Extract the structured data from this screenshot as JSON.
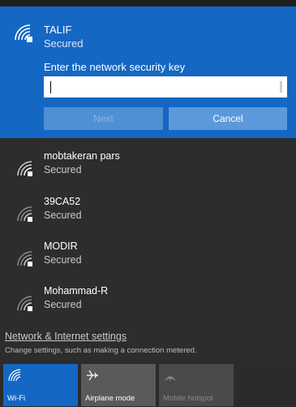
{
  "colors": {
    "accent": "#1567c4",
    "flyout_bg": "#2d2d2d",
    "button_disabled": "#4f8fd3",
    "button_active": "#5b99da"
  },
  "selected_network": {
    "icon": "wifi-secured-icon",
    "name": "TALIF",
    "status": "Secured",
    "key_label": "Enter the network security key",
    "key_value": "",
    "next_label": "Next",
    "cancel_label": "Cancel"
  },
  "networks": [
    {
      "icon": "wifi-secured-icon",
      "name": "mobtakeran pars",
      "status": "Secured"
    },
    {
      "icon": "wifi-secured-icon",
      "name": "39CA52",
      "status": "Secured"
    },
    {
      "icon": "wifi-secured-icon",
      "name": "MODIR",
      "status": "Secured"
    },
    {
      "icon": "wifi-secured-icon",
      "name": "Mohammad-R",
      "status": "Secured"
    }
  ],
  "settings": {
    "link_label": "Network & Internet settings",
    "description": "Change settings, such as making a connection metered."
  },
  "quick_actions": [
    {
      "icon": "wifi-icon",
      "label": "Wi-Fi",
      "state": "on"
    },
    {
      "icon": "airplane-icon",
      "label": "Airplane mode",
      "state": "off"
    },
    {
      "icon": "hotspot-icon",
      "label": "Mobile hotspot",
      "state": "disabled"
    }
  ]
}
